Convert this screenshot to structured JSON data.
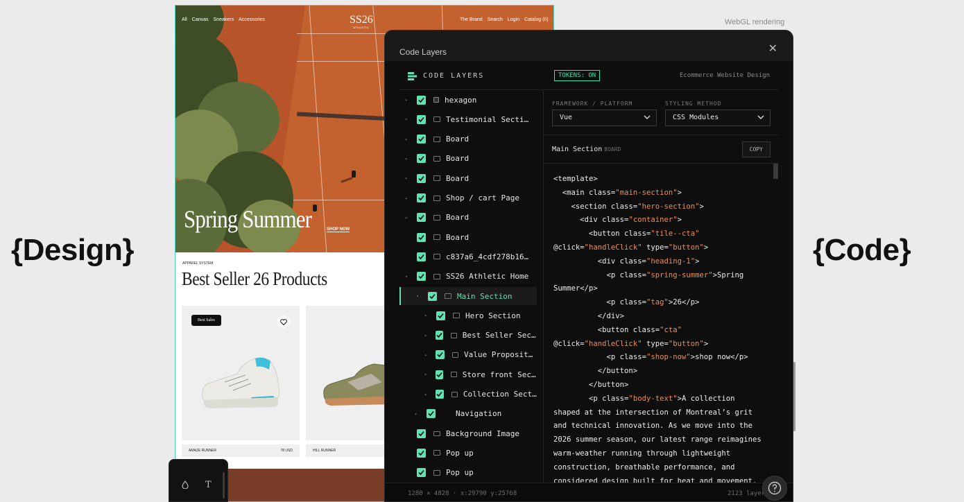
{
  "left_label": "{Design}",
  "right_label": "{Code}",
  "webgl_note": "WebGL rendering",
  "design": {
    "nav_left": [
      "All",
      "Canvas",
      "Sneakers",
      "Accessories"
    ],
    "logo": "SS26",
    "logo_sub": "ATHLETIC",
    "nav_right": [
      "The Brand",
      "Search",
      "Login",
      "Catalog (0)"
    ],
    "hero_title": "Spring Summer",
    "shop_now": "SHOP NOW",
    "apparel": "APPAREL SYSTEM",
    "best_title": "Best Seller 26 Products",
    "badge": "Best Sales",
    "products": [
      {
        "name": "AMAZE RUNNER",
        "price": "78 USD"
      },
      {
        "name": "HILL RUNNER",
        "price": ""
      }
    ]
  },
  "panel": {
    "title": "Code Layers",
    "section_label": "CODE LAYERS",
    "tokens": "TOKENS: ON",
    "project": "Ecommerce Website Design",
    "framework_label": "FRAMEWORK / PLATFORM",
    "framework_value": "Vue",
    "styling_label": "STYLING METHOD",
    "styling_value": "CSS Modules",
    "section_name": "Main Section",
    "section_type": "BOARD",
    "copy": "COPY",
    "layers": [
      {
        "name": "hexagon"
      },
      {
        "name": "Testimonial Section"
      },
      {
        "name": "Board"
      },
      {
        "name": "Board"
      },
      {
        "name": "Board"
      },
      {
        "name": "Shop / cart Page"
      },
      {
        "name": "Board"
      },
      {
        "name": "Board"
      },
      {
        "name": "c837a6_4cdf278b16..."
      },
      {
        "name": "SS26 Athletic Home"
      },
      {
        "name": "Main Section"
      },
      {
        "name": "Hero Section"
      },
      {
        "name": "Best Seller Section"
      },
      {
        "name": "Value Proposition"
      },
      {
        "name": "Store front Section"
      },
      {
        "name": "Collection Section"
      },
      {
        "name": "Navigation"
      },
      {
        "name": "Background Image"
      },
      {
        "name": "Pop up"
      },
      {
        "name": "Pop up"
      }
    ],
    "status_left": "1280 × 4828 · x:29790 y:25768",
    "status_right": "2123 layers"
  }
}
